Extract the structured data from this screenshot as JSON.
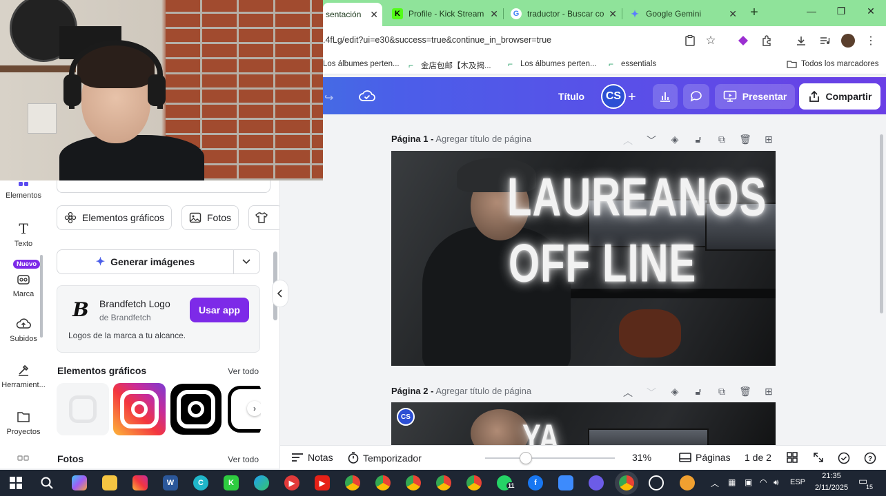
{
  "browser": {
    "tabs": [
      {
        "label": "sentación",
        "favicon_color": "#00c4cc",
        "active": true
      },
      {
        "label": "Profile - Kick Stream",
        "favicon_color": "#53fc18",
        "favicon_glyph": "K"
      },
      {
        "label": "traductor - Buscar co",
        "favicon_color": "#4285f4",
        "favicon_glyph": "G"
      },
      {
        "label": "Google Gemini",
        "favicon_color": "#6b8cff",
        "favicon_glyph": "✦"
      }
    ],
    "url": ".4fLg/edit?ui=e30&success=true&continue_in_browser=true",
    "bookmarks": [
      "Los álbumes perten...",
      "金店包邮【木及揭...",
      "Los álbumes perten...",
      "essentials"
    ],
    "all_bookmarks_label": "Todos los marcadores"
  },
  "canva_header": {
    "title": "Título",
    "avatar_initials": "CS",
    "present_label": "Presentar",
    "share_label": "Compartir"
  },
  "rail": {
    "items": [
      {
        "label": "Elementos",
        "icon": "elements-icon"
      },
      {
        "label": "Texto",
        "icon": "text-icon"
      },
      {
        "label": "Marca",
        "icon": "brand-icon"
      },
      {
        "label": "Subidos",
        "icon": "upload-icon"
      },
      {
        "label": "Herramient...",
        "icon": "tools-icon"
      },
      {
        "label": "Proyectos",
        "icon": "folder-icon"
      }
    ],
    "new_badge": "Nuevo"
  },
  "panel": {
    "chips": [
      "Elementos gráficos",
      "Fotos"
    ],
    "generate_label": "Generar imágenes",
    "app_card": {
      "name": "Brandfetch Logo",
      "by": "de Brandfetch",
      "button": "Usar app",
      "description": "Logos de la marca a tu alcance."
    },
    "graphics_section": {
      "title": "Elementos gráficos",
      "link": "Ver todo"
    },
    "photos_section": {
      "title": "Fotos",
      "link": "Ver todo"
    }
  },
  "pages": [
    {
      "number": "Página 1 -",
      "subtitle": "Agregar título de página",
      "line1": "LAUREANOS",
      "line2": "OFF LINE"
    },
    {
      "number": "Página 2 -",
      "subtitle": "Agregar título de página",
      "line1": "YA"
    }
  ],
  "footer": {
    "notes": "Notas",
    "timer": "Temporizador",
    "zoom": "31%",
    "pages_label": "Páginas",
    "page_count": "1 de 2"
  },
  "taskbar": {
    "language": "ESP",
    "time": "21:35",
    "date": "2/11/2025",
    "notifications": "15",
    "whatsapp_badge": "11"
  },
  "colors": {
    "canva_purple": "#7d2ae8",
    "chrome_tab_green": "#8fe39a",
    "taskbar": "#1e2633"
  }
}
